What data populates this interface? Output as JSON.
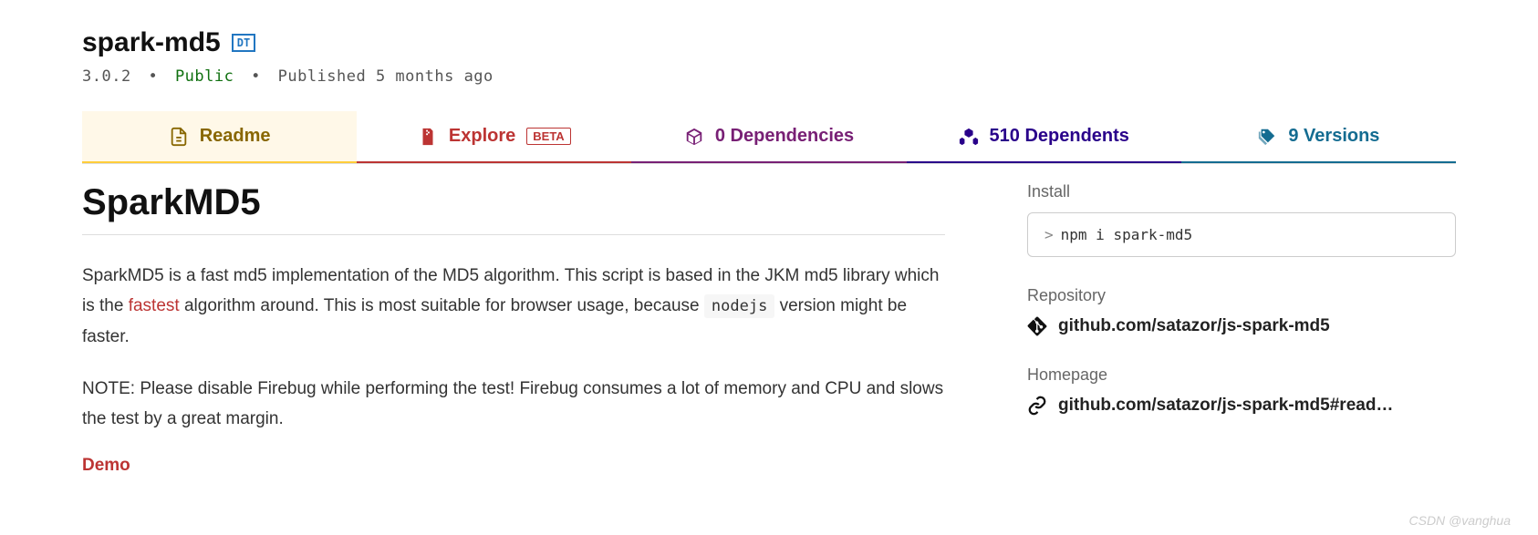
{
  "package": {
    "name": "spark-md5",
    "dt_badge": "DT",
    "version": "3.0.2",
    "visibility": "Public",
    "published": "Published 5 months ago"
  },
  "tabs": {
    "readme": "Readme",
    "explore": "Explore",
    "explore_badge": "BETA",
    "dependencies": "0 Dependencies",
    "dependents": "510 Dependents",
    "versions": "9 Versions"
  },
  "readme": {
    "title": "SparkMD5",
    "p1_a": "SparkMD5 is a fast md5 implementation of the MD5 algorithm. This script is based in the JKM md5 library which is the ",
    "p1_link": "fastest",
    "p1_b": " algorithm around. This is most suitable for browser usage, because ",
    "p1_code": "nodejs",
    "p1_c": " version might be faster.",
    "p2": "NOTE: Please disable Firebug while performing the test! Firebug consumes a lot of memory and CPU and slows the test by a great margin.",
    "demo": "Demo"
  },
  "sidebar": {
    "install_label": "Install",
    "install_cmd": "npm i spark-md5",
    "repo_label": "Repository",
    "repo_link": "github.com/satazor/js-spark-md5",
    "home_label": "Homepage",
    "home_link": "github.com/satazor/js-spark-md5#read…"
  },
  "watermark": "CSDN @vanghua"
}
